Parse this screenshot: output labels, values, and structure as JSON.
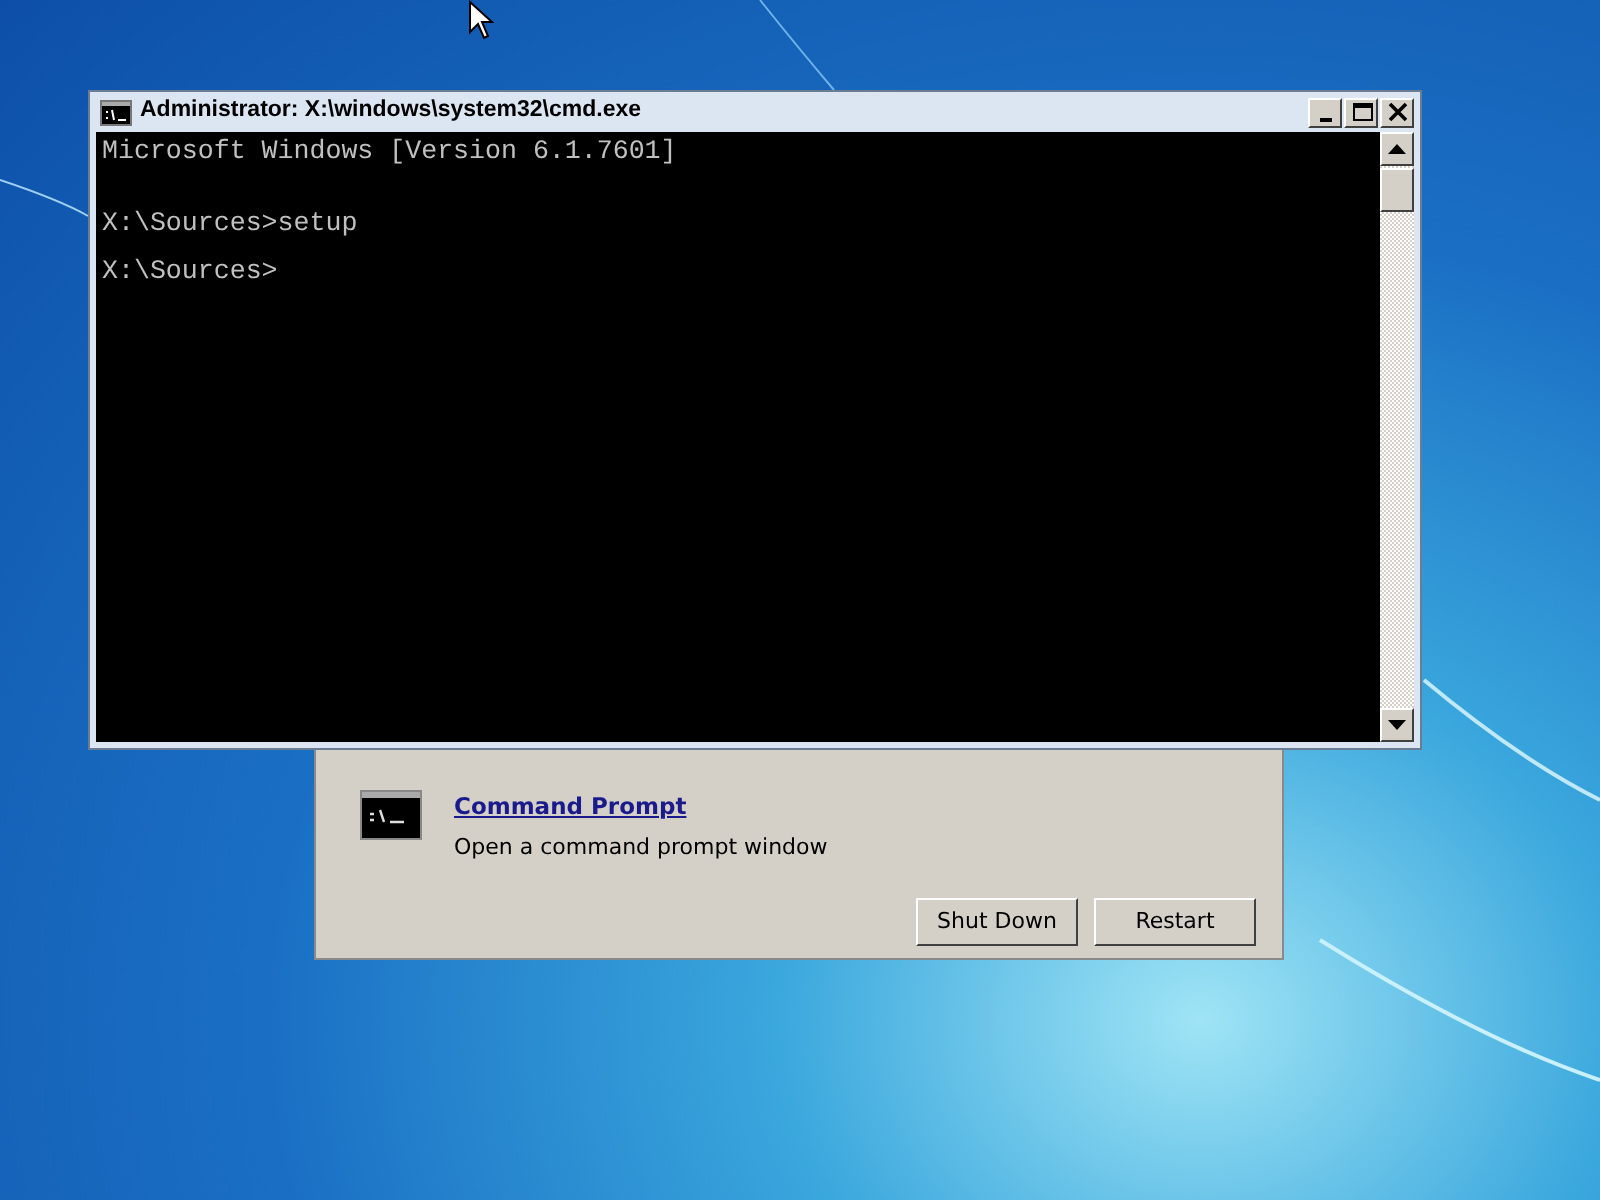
{
  "console_window": {
    "title": "Administrator: X:\\windows\\system32\\cmd.exe",
    "lines": [
      "Microsoft Windows [Version 6.1.7601]",
      "X:\\Sources>setup",
      "X:\\Sources>"
    ]
  },
  "recovery_dialog": {
    "tool": {
      "name": "Command Prompt",
      "description": "Open a command prompt window"
    },
    "buttons": [
      "Shut Down",
      "Restart"
    ]
  }
}
